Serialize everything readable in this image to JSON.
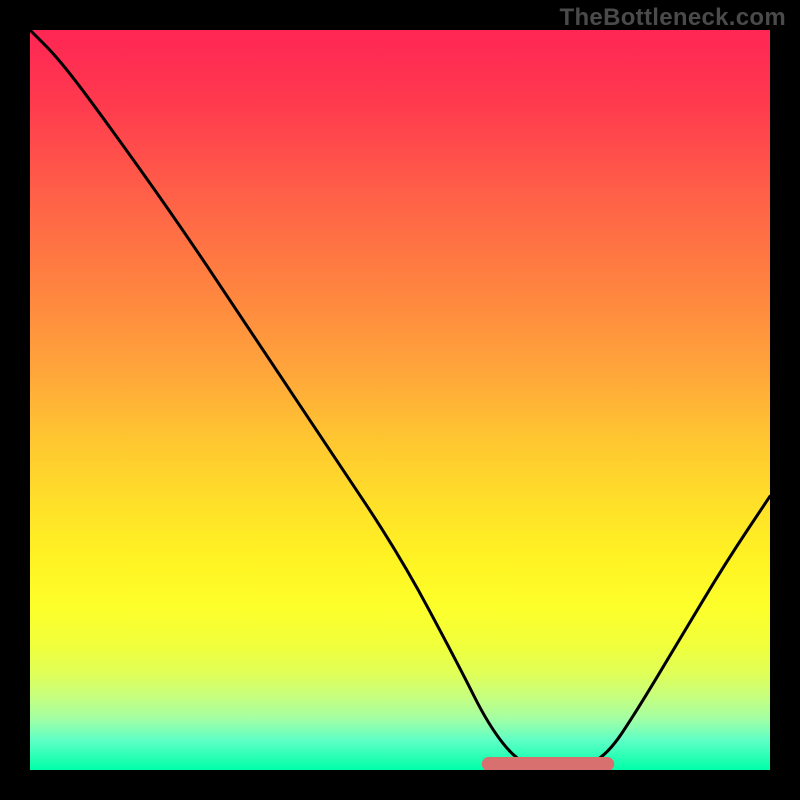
{
  "watermark": "TheBottleneck.com",
  "colors": {
    "page_background": "#000000",
    "watermark_text": "#4a4a4a",
    "curve_stroke": "#000000",
    "flat_band_stroke": "#d7706e",
    "gradient_top": "#ff2654",
    "gradient_bottom": "#00ffa9"
  },
  "chart_data": {
    "type": "line",
    "title": "",
    "xlabel": "",
    "ylabel": "",
    "xlim": [
      0,
      100
    ],
    "ylim": [
      0,
      100
    ],
    "grid": false,
    "legend": false,
    "series": [
      {
        "name": "bottleneck-curve",
        "x": [
          0,
          4,
          10,
          20,
          30,
          40,
          50,
          58,
          62,
          66,
          70,
          74,
          78,
          82,
          88,
          94,
          100
        ],
        "values": [
          100,
          96,
          88,
          74,
          59,
          44,
          29,
          14,
          6,
          1,
          0,
          0,
          2,
          8,
          18,
          28,
          37
        ]
      }
    ],
    "optimal_band": {
      "x_start": 62,
      "x_end": 78,
      "y": 0
    }
  }
}
